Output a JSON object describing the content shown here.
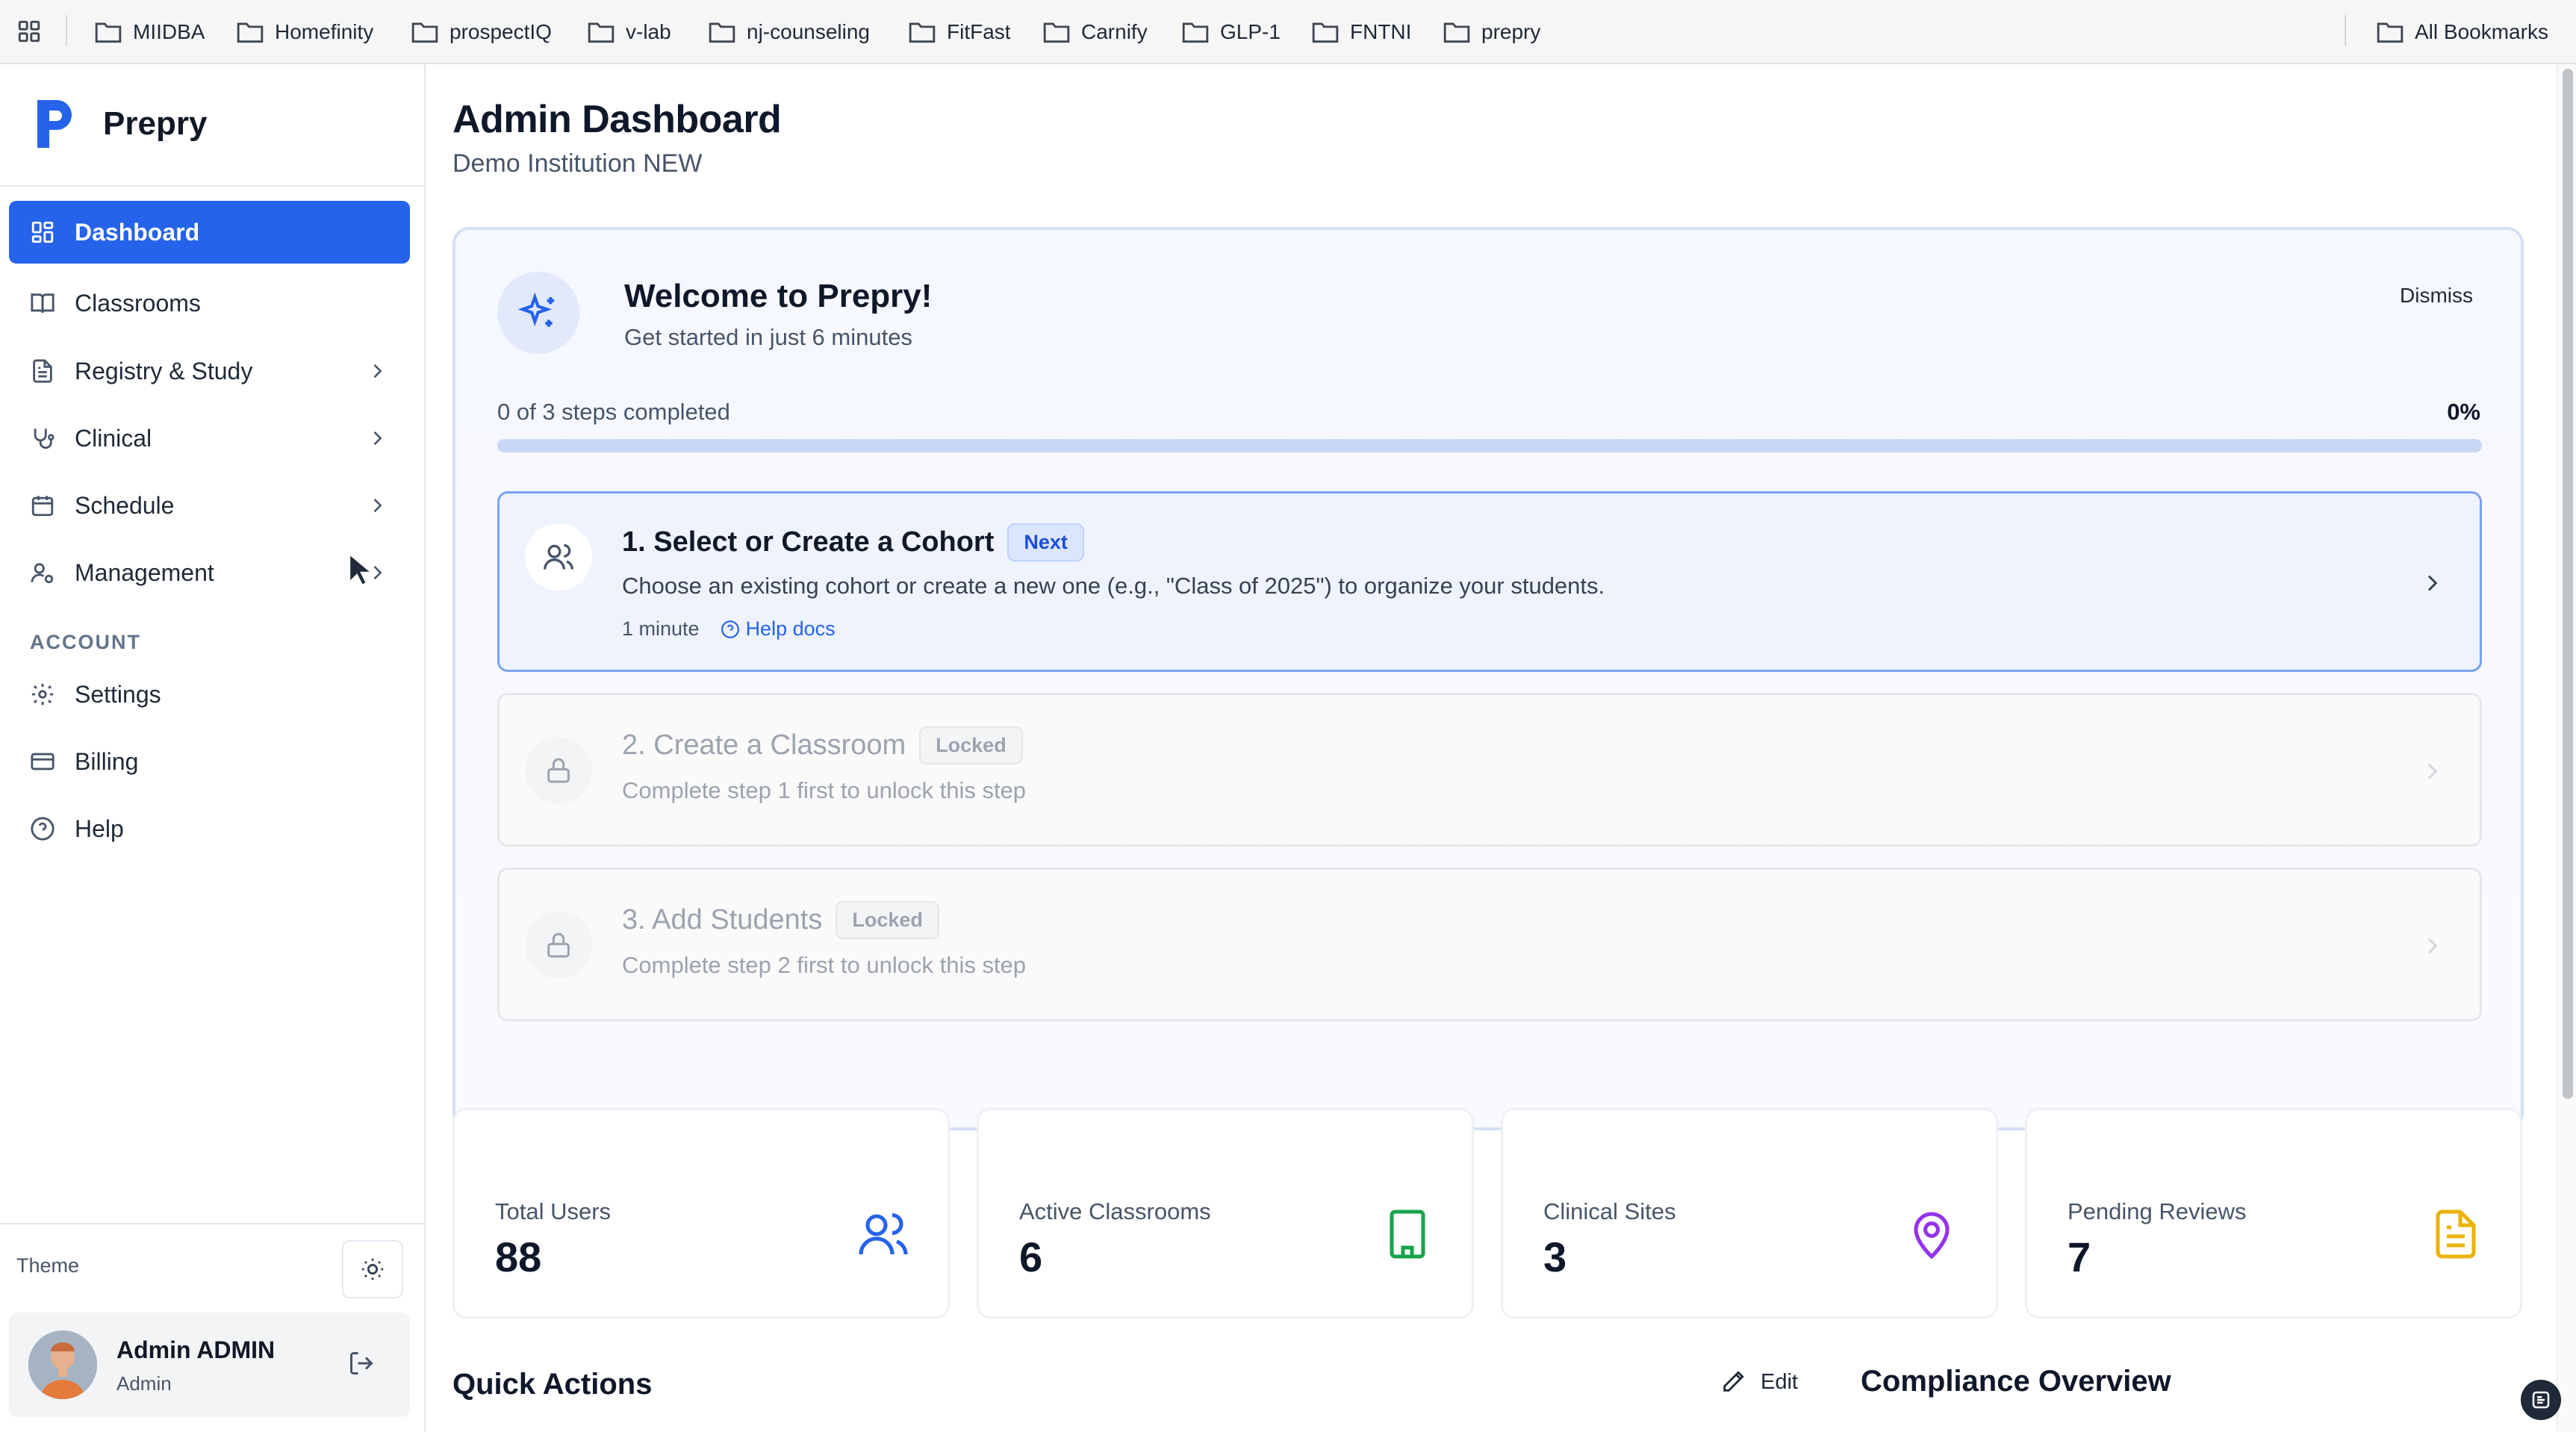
{
  "bookmarks": {
    "items": [
      "MIIDBA",
      "Homefinity",
      "prospectIQ",
      "v-lab",
      "nj-counseling",
      "FitFast",
      "Carnify",
      "GLP-1",
      "FNTNI",
      "prepry"
    ],
    "all": "All Bookmarks"
  },
  "brand": {
    "name": "Prepry"
  },
  "sidebar": {
    "items": [
      {
        "label": "Dashboard",
        "icon": "dashboard-grid-icon",
        "active": true
      },
      {
        "label": "Classrooms",
        "icon": "book-open-icon"
      },
      {
        "label": "Registry & Study",
        "icon": "file-text-icon",
        "expandable": true
      },
      {
        "label": "Clinical",
        "icon": "stethoscope-icon",
        "expandable": true
      },
      {
        "label": "Schedule",
        "icon": "calendar-icon",
        "expandable": true
      },
      {
        "label": "Management",
        "icon": "user-cog-icon",
        "expandable": true
      }
    ],
    "account_label": "ACCOUNT",
    "account_items": [
      {
        "label": "Settings",
        "icon": "gear-icon"
      },
      {
        "label": "Billing",
        "icon": "credit-card-icon"
      },
      {
        "label": "Help",
        "icon": "help-circle-icon"
      }
    ],
    "theme_label": "Theme",
    "user": {
      "name": "Admin ADMIN",
      "role": "Admin"
    }
  },
  "page": {
    "title": "Admin Dashboard",
    "subtitle": "Demo Institution NEW"
  },
  "welcome": {
    "title": "Welcome to Prepry!",
    "subtitle": "Get started in just 6 minutes",
    "dismiss": "Dismiss",
    "progress_text": "0 of 3 steps completed",
    "progress_percent": "0%",
    "progress_value": 0,
    "steps": [
      {
        "title": "1. Select or Create a Cohort",
        "badge": "Next",
        "desc": "Choose an existing cohort or create a new one (e.g., \"Class of 2025\") to organize your students.",
        "time": "1 minute",
        "help": "Help docs"
      },
      {
        "title": "2. Create a Classroom",
        "badge": "Locked",
        "desc": "Complete step 1 first to unlock this step"
      },
      {
        "title": "3. Add Students",
        "badge": "Locked",
        "desc": "Complete step 2 first to unlock this step"
      }
    ]
  },
  "stats": [
    {
      "label": "Total Users",
      "value": "88",
      "color": "#2563eb",
      "icon": "users-icon"
    },
    {
      "label": "Active Classrooms",
      "value": "6",
      "color": "#16a34a",
      "icon": "building-icon"
    },
    {
      "label": "Clinical Sites",
      "value": "3",
      "color": "#9333ea",
      "icon": "map-pin-icon"
    },
    {
      "label": "Pending Reviews",
      "value": "7",
      "color": "#eab308",
      "icon": "document-icon"
    }
  ],
  "quick_actions": {
    "title": "Quick Actions",
    "edit": "Edit"
  },
  "compliance": {
    "title": "Compliance Overview"
  }
}
